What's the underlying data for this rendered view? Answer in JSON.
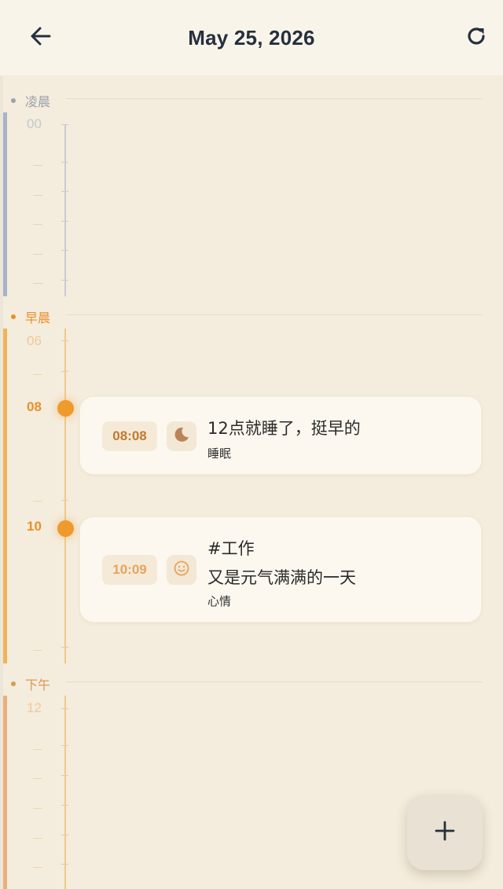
{
  "header": {
    "title": "May 25, 2026",
    "back_icon": "arrow-left-icon",
    "refresh_icon": "refresh-icon"
  },
  "sections": [
    {
      "label": "凌晨",
      "first_hour": "00",
      "color": "#a8b3c8",
      "label_color": "#9aa2ad"
    },
    {
      "label": "早晨",
      "first_hour": "06",
      "color": "#f0b35c",
      "label_color": "#e8902a"
    },
    {
      "label": "下午",
      "first_hour": "12",
      "color": "#e9b07e",
      "label_color": "#d99a55"
    }
  ],
  "hour_labels": [
    {
      "label": "08",
      "style": "strong"
    },
    {
      "label": "10",
      "style": "strong"
    }
  ],
  "events": [
    {
      "time": "08:08",
      "time_color": "#c07a2e",
      "icon": "moon-icon",
      "text": "12点就睡了，挺早的",
      "category": "睡眠"
    },
    {
      "time": "10:09",
      "time_color": "#e6a45c",
      "icon": "smile-icon",
      "tag": "#工作",
      "text": "又是元气满满的一天",
      "category": "心情"
    }
  ],
  "fab": {
    "icon": "plus-icon"
  }
}
